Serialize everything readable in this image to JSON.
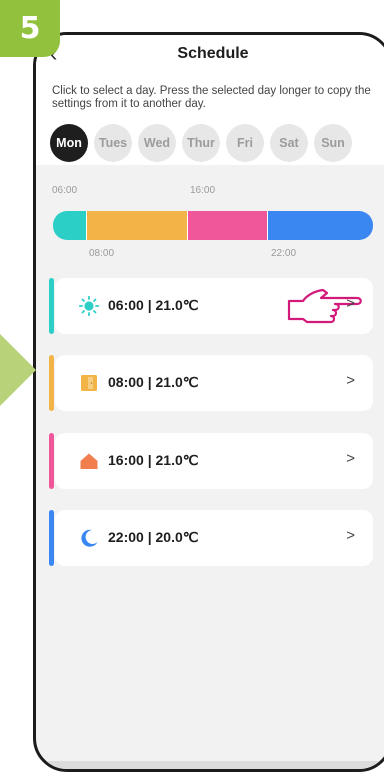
{
  "step_number": "5",
  "header": {
    "back_glyph": "‹",
    "title": "Schedule",
    "hint": "Click to select a day. Press the selected day longer to copy the settings from it to another day."
  },
  "days": [
    "Mon",
    "Tues",
    "Wed",
    "Thur",
    "Fri",
    "Sat",
    "Sun"
  ],
  "selected_day": "Mon",
  "timeline": {
    "top_labels": [
      "06:00",
      "16:00"
    ],
    "bottom_labels": [
      "08:00",
      "22:00"
    ],
    "segments": [
      {
        "color": "#2ccfc6",
        "start": "06:00",
        "end": "08:00"
      },
      {
        "color": "#f2b446",
        "start": "08:00",
        "end": "16:00"
      },
      {
        "color": "#f0569a",
        "start": "16:00",
        "end": "22:00"
      },
      {
        "color": "#3a87f2",
        "start": "22:00",
        "end": "06:00"
      }
    ]
  },
  "schedule": [
    {
      "label": "06:00 | 21.0℃",
      "icon": "sun-icon",
      "color": "#2ccfc6"
    },
    {
      "label": "08:00 | 21.0℃",
      "icon": "door-icon",
      "color": "#f2b446"
    },
    {
      "label": "16:00 | 21.0℃",
      "icon": "home-icon",
      "color": "#f0569a"
    },
    {
      "label": "22:00 | 20.0℃",
      "icon": "moon-icon",
      "color": "#3a87f2"
    }
  ],
  "chevron_glyph": ">",
  "colors": {
    "step_badge": "#92c13e",
    "side_arrow": "#b8d27a",
    "pointer_hand": "#d21a7a",
    "active_day": "#1e1e1e"
  }
}
